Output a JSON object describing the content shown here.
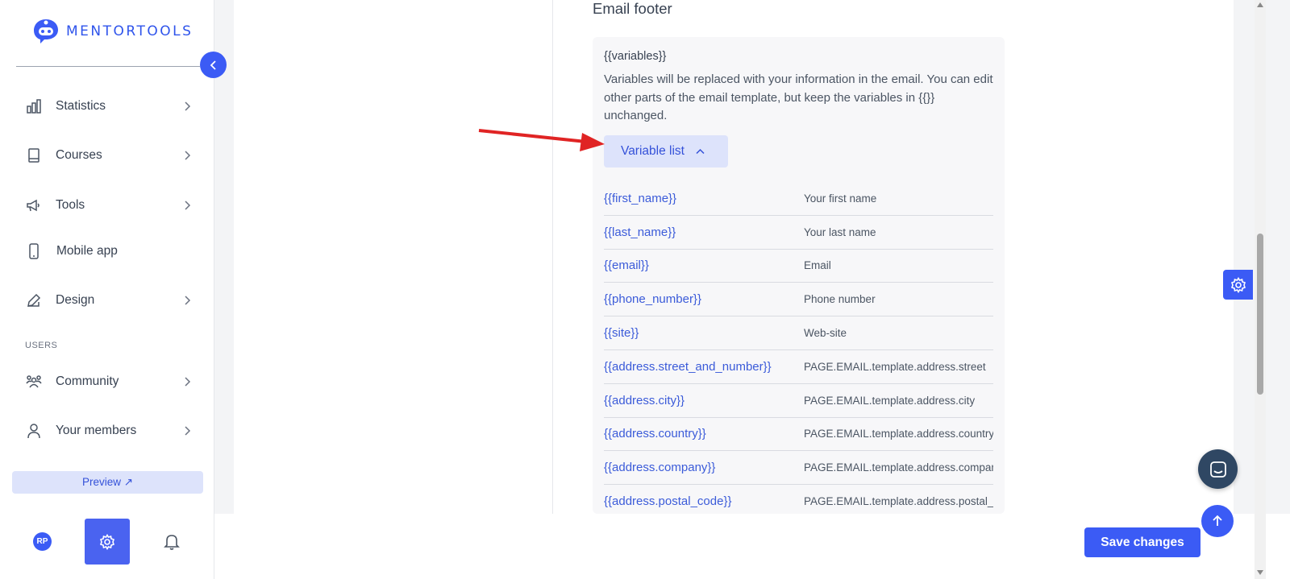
{
  "brand": {
    "name": "MENTORTOOLS",
    "color": "#3b5bf5"
  },
  "sidebar": {
    "collapse_icon": "chevron-left-icon",
    "items": [
      {
        "label": "Statistics",
        "icon": "bar-chart-icon",
        "has_submenu": true
      },
      {
        "label": "Courses",
        "icon": "book-icon",
        "has_submenu": true
      },
      {
        "label": "Tools",
        "icon": "megaphone-icon",
        "has_submenu": true
      },
      {
        "label": "Mobile app",
        "icon": "mobile-icon",
        "has_submenu": false
      },
      {
        "label": "Design",
        "icon": "pencil-icon",
        "has_submenu": true
      }
    ],
    "users_section_label": "USERS",
    "user_items": [
      {
        "label": "Community",
        "icon": "community-icon",
        "has_submenu": true
      },
      {
        "label": "Your members",
        "icon": "user-icon",
        "has_submenu": true
      }
    ],
    "preview_label": "Preview ↗",
    "avatar_initials": "RP"
  },
  "email_footer": {
    "title": "Email footer",
    "variables_heading": "{{variables}}",
    "description": "Variables will be replaced with your information in the email. You can edit other parts of the email template, but keep the variables in {{}} unchanged.",
    "variable_list_label": "Variable list",
    "variables": [
      {
        "key": "{{first_name}}",
        "value": "Your first name"
      },
      {
        "key": "{{last_name}}",
        "value": "Your last name"
      },
      {
        "key": "{{email}}",
        "value": "Email"
      },
      {
        "key": "{{phone_number}}",
        "value": "Phone number"
      },
      {
        "key": "{{site}}",
        "value": "Web-site"
      },
      {
        "key": "{{address.street_and_number}}",
        "value": "PAGE.EMAIL.template.address.street"
      },
      {
        "key": "{{address.city}}",
        "value": "PAGE.EMAIL.template.address.city"
      },
      {
        "key": "{{address.country}}",
        "value": "PAGE.EMAIL.template.address.country"
      },
      {
        "key": "{{address.company}}",
        "value": "PAGE.EMAIL.template.address.company"
      },
      {
        "key": "{{address.postal_code}}",
        "value": "PAGE.EMAIL.template.address.postal_code"
      }
    ]
  },
  "actions": {
    "save_label": "Save changes"
  },
  "annotation": {
    "arrow_color": "#e02424"
  }
}
